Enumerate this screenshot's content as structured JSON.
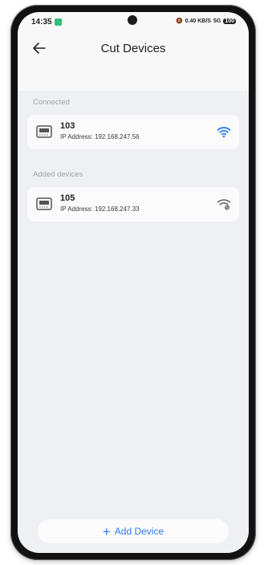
{
  "status_bar": {
    "time": "14:35",
    "network_speed": "0.40 KB/S",
    "network_type": "5G",
    "battery": "100"
  },
  "header": {
    "title": "Cut Devices"
  },
  "sections": {
    "connected_label": "Connected",
    "added_label": "Added devices"
  },
  "connected_devices": [
    {
      "name": "103",
      "ip": "IP Address: 192.168.247.56",
      "wifi_state": "connected"
    }
  ],
  "added_devices": [
    {
      "name": "105",
      "ip": "IP Address: 192.168.247.33",
      "wifi_state": "offline"
    }
  ],
  "footer": {
    "add_device_label": "Add Device"
  },
  "colors": {
    "accent": "#2a7df0",
    "wifi_connected": "#2a7df0",
    "wifi_offline": "#555555"
  },
  "icons": [
    "back-arrow-icon",
    "device-icon",
    "wifi-icon",
    "wifi-off-icon",
    "plus-icon"
  ]
}
